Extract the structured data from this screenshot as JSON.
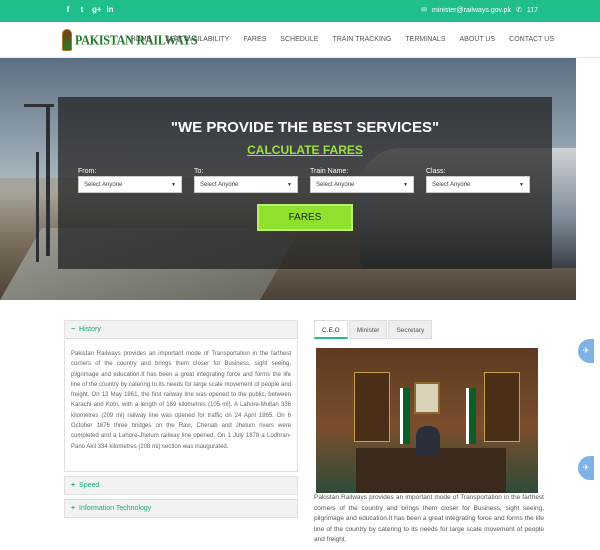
{
  "topbar": {
    "social": [
      {
        "icon": "facebook-icon",
        "glyph": "f"
      },
      {
        "icon": "twitter-icon",
        "glyph": "t"
      },
      {
        "icon": "google-plus-icon",
        "glyph": "g+"
      },
      {
        "icon": "linkedin-icon",
        "glyph": "in"
      }
    ],
    "email": "minister@railways.gov.pk",
    "phone": "117",
    "color": "#1fbe8c"
  },
  "logo": {
    "text": "PAKISTAN RAILWAYS"
  },
  "nav": {
    "items": [
      "HOME",
      "SEAT AVAILABILITY",
      "FARES",
      "SCHEDULE",
      "TRAIN TRACKING",
      "TERMINALS",
      "ABOUT US",
      "CONTACT US"
    ]
  },
  "hero": {
    "headline": "\"WE PROVIDE THE BEST SERVICES\"",
    "subheadline": "CALCULATE FARES",
    "fields": [
      {
        "label": "From:",
        "value": "Select Anyone"
      },
      {
        "label": "To:",
        "value": "Select Anyone"
      },
      {
        "label": "Train Name:",
        "value": "Select Anyone"
      },
      {
        "label": "Class:",
        "value": "Select Anyone"
      }
    ],
    "button": "FARES",
    "accent": "#8fe12e"
  },
  "accordion": {
    "sections": [
      {
        "title": "History",
        "sign": "−",
        "expanded": true,
        "body": "Pakistan Railways provides an important mode of Transportation in the farthest corners of the country and brings them closer for Business, sight seeing, pilgrimage and education.It has been a great integrating force and forms the life line of the country by catering to its needs for large scale movement of people and freight. On 13 May 1861, the first railway line was opened to the public, between Karachi and Kotri, with a length of 169 kilometres (105 mi). A Lahore-Multan 336 kilometres (209 mi) railway line was opened for traffic on 24 April 1865. On 6 October 1876 three bridges on the Ravi, Chenab and Jhelum rivers were completed and a Lahore-Jhelum railway line opened. On 1 July 1878 a Lodhran-Pano Akil 334 kilometres (208 mi) section was inaugurated."
      },
      {
        "title": "Speed",
        "sign": "+",
        "expanded": false
      },
      {
        "title": "Information Technology",
        "sign": "+",
        "expanded": false
      }
    ]
  },
  "tabs": {
    "items": [
      "C.E.O",
      "Minister",
      "Secretary"
    ],
    "active": "C.E.O",
    "caption": "Pakistan Railways provides an important mode of Transportation in the farthest corners of the country and brings them closer for Business, sight seeing, pilgrimage and education.It has been a great integrating force and forms the life line of the country by catering to its needs for large scale movement of people and freight."
  }
}
